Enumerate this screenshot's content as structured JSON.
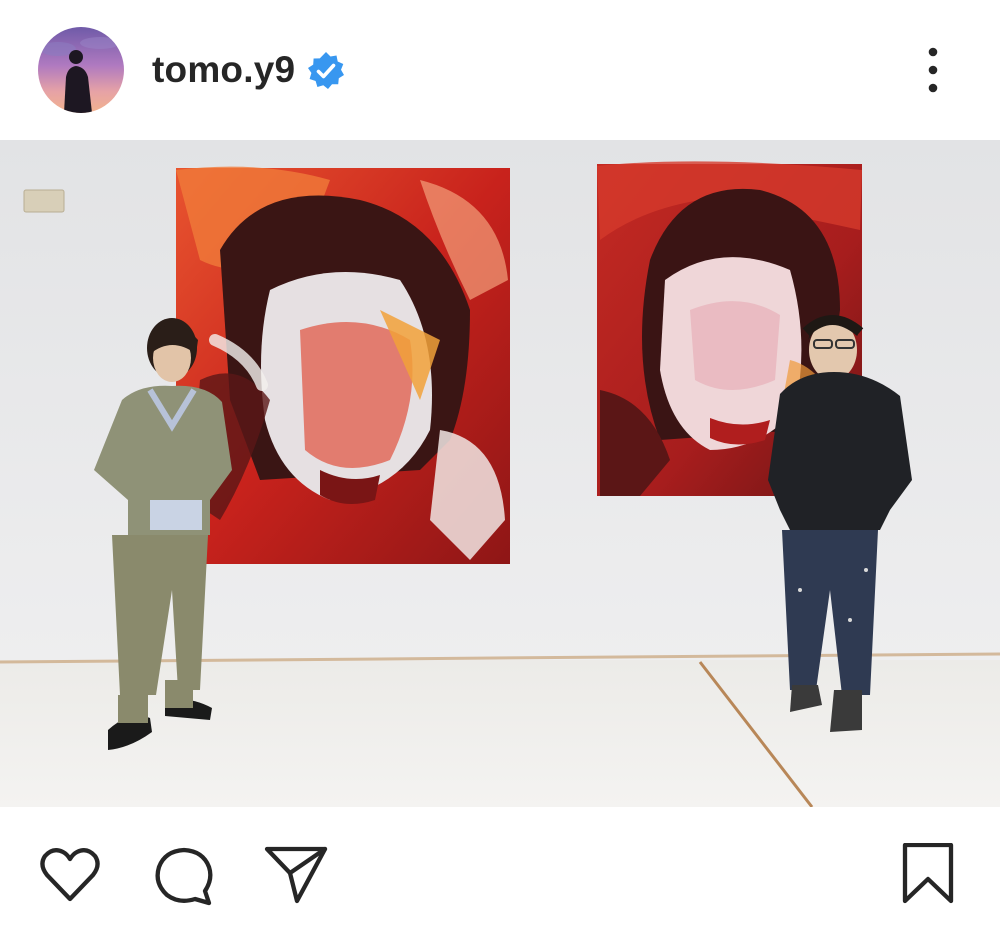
{
  "post": {
    "username": "tomo.y9",
    "verified": true,
    "accent_verified": "#3897f0",
    "text_color": "#262626"
  },
  "header": {
    "avatar_icon": "avatar",
    "verified_icon": "verified-badge-icon",
    "more_icon": "more-options-icon"
  },
  "actions": {
    "like_icon": "heart-icon",
    "comment_icon": "comment-icon",
    "share_icon": "send-icon",
    "save_icon": "bookmark-icon"
  }
}
